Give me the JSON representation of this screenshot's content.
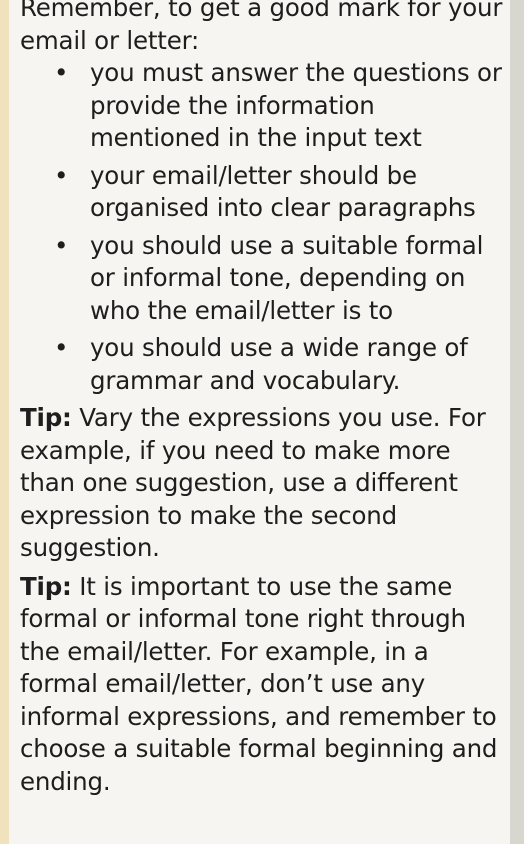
{
  "intro": "Remember, to get a good mark for your email or letter:",
  "bullet_symbol": "•",
  "points": [
    "you must answer the questions or provide the information mentioned in the input text",
    "your email/letter should be organised into clear paragraphs",
    "you should use a suitable formal or informal tone, depending on who the email/letter is to",
    "you should use a wide range of grammar and vocabulary."
  ],
  "tips": [
    {
      "label": "Tip:",
      "text": " Vary the expressions you use. For example, if you need to make more than one suggestion, use a different expression to make the second suggestion."
    },
    {
      "label": "Tip:",
      "text": " It is important to use the same formal or informal tone right through the email/letter. For example, in a formal email/letter, don’t use any informal expressions, and remember to choose a suitable formal beginning and ending."
    }
  ]
}
